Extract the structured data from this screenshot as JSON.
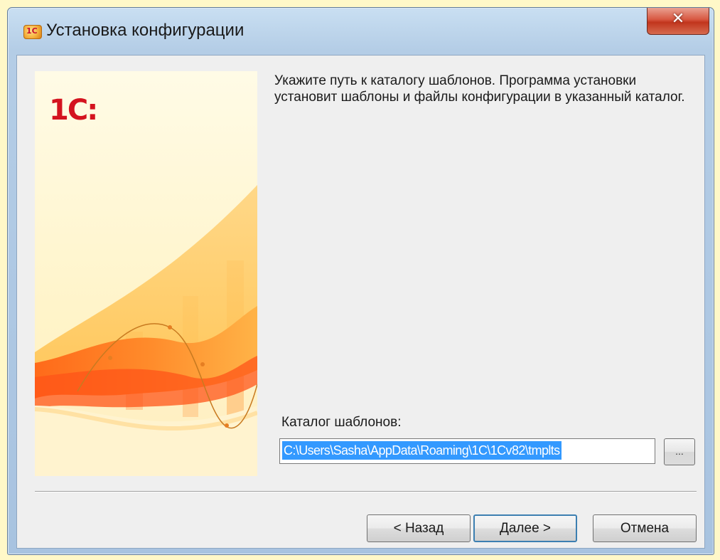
{
  "window": {
    "title": "Установка конфигурации",
    "app_icon_glyph": "1С",
    "close_glyph": "✕"
  },
  "side_panel": {
    "logo_text": "1С:"
  },
  "content": {
    "instruction": "Укажите путь к каталогу шаблонов. Программа установки установит шаблоны и файлы конфигурации в указанный каталог.",
    "catalog_label": "Каталог шаблонов:",
    "catalog_path": "C:\\Users\\Sasha\\AppData\\Roaming\\1C\\1Cv82\\tmplts",
    "browse_label": "..."
  },
  "buttons": {
    "back": "< Назад",
    "next": "Далее >",
    "cancel": "Отмена"
  },
  "colors": {
    "accent": "#d4131f",
    "selection": "#3399ff",
    "close_button": "#c1351d"
  }
}
